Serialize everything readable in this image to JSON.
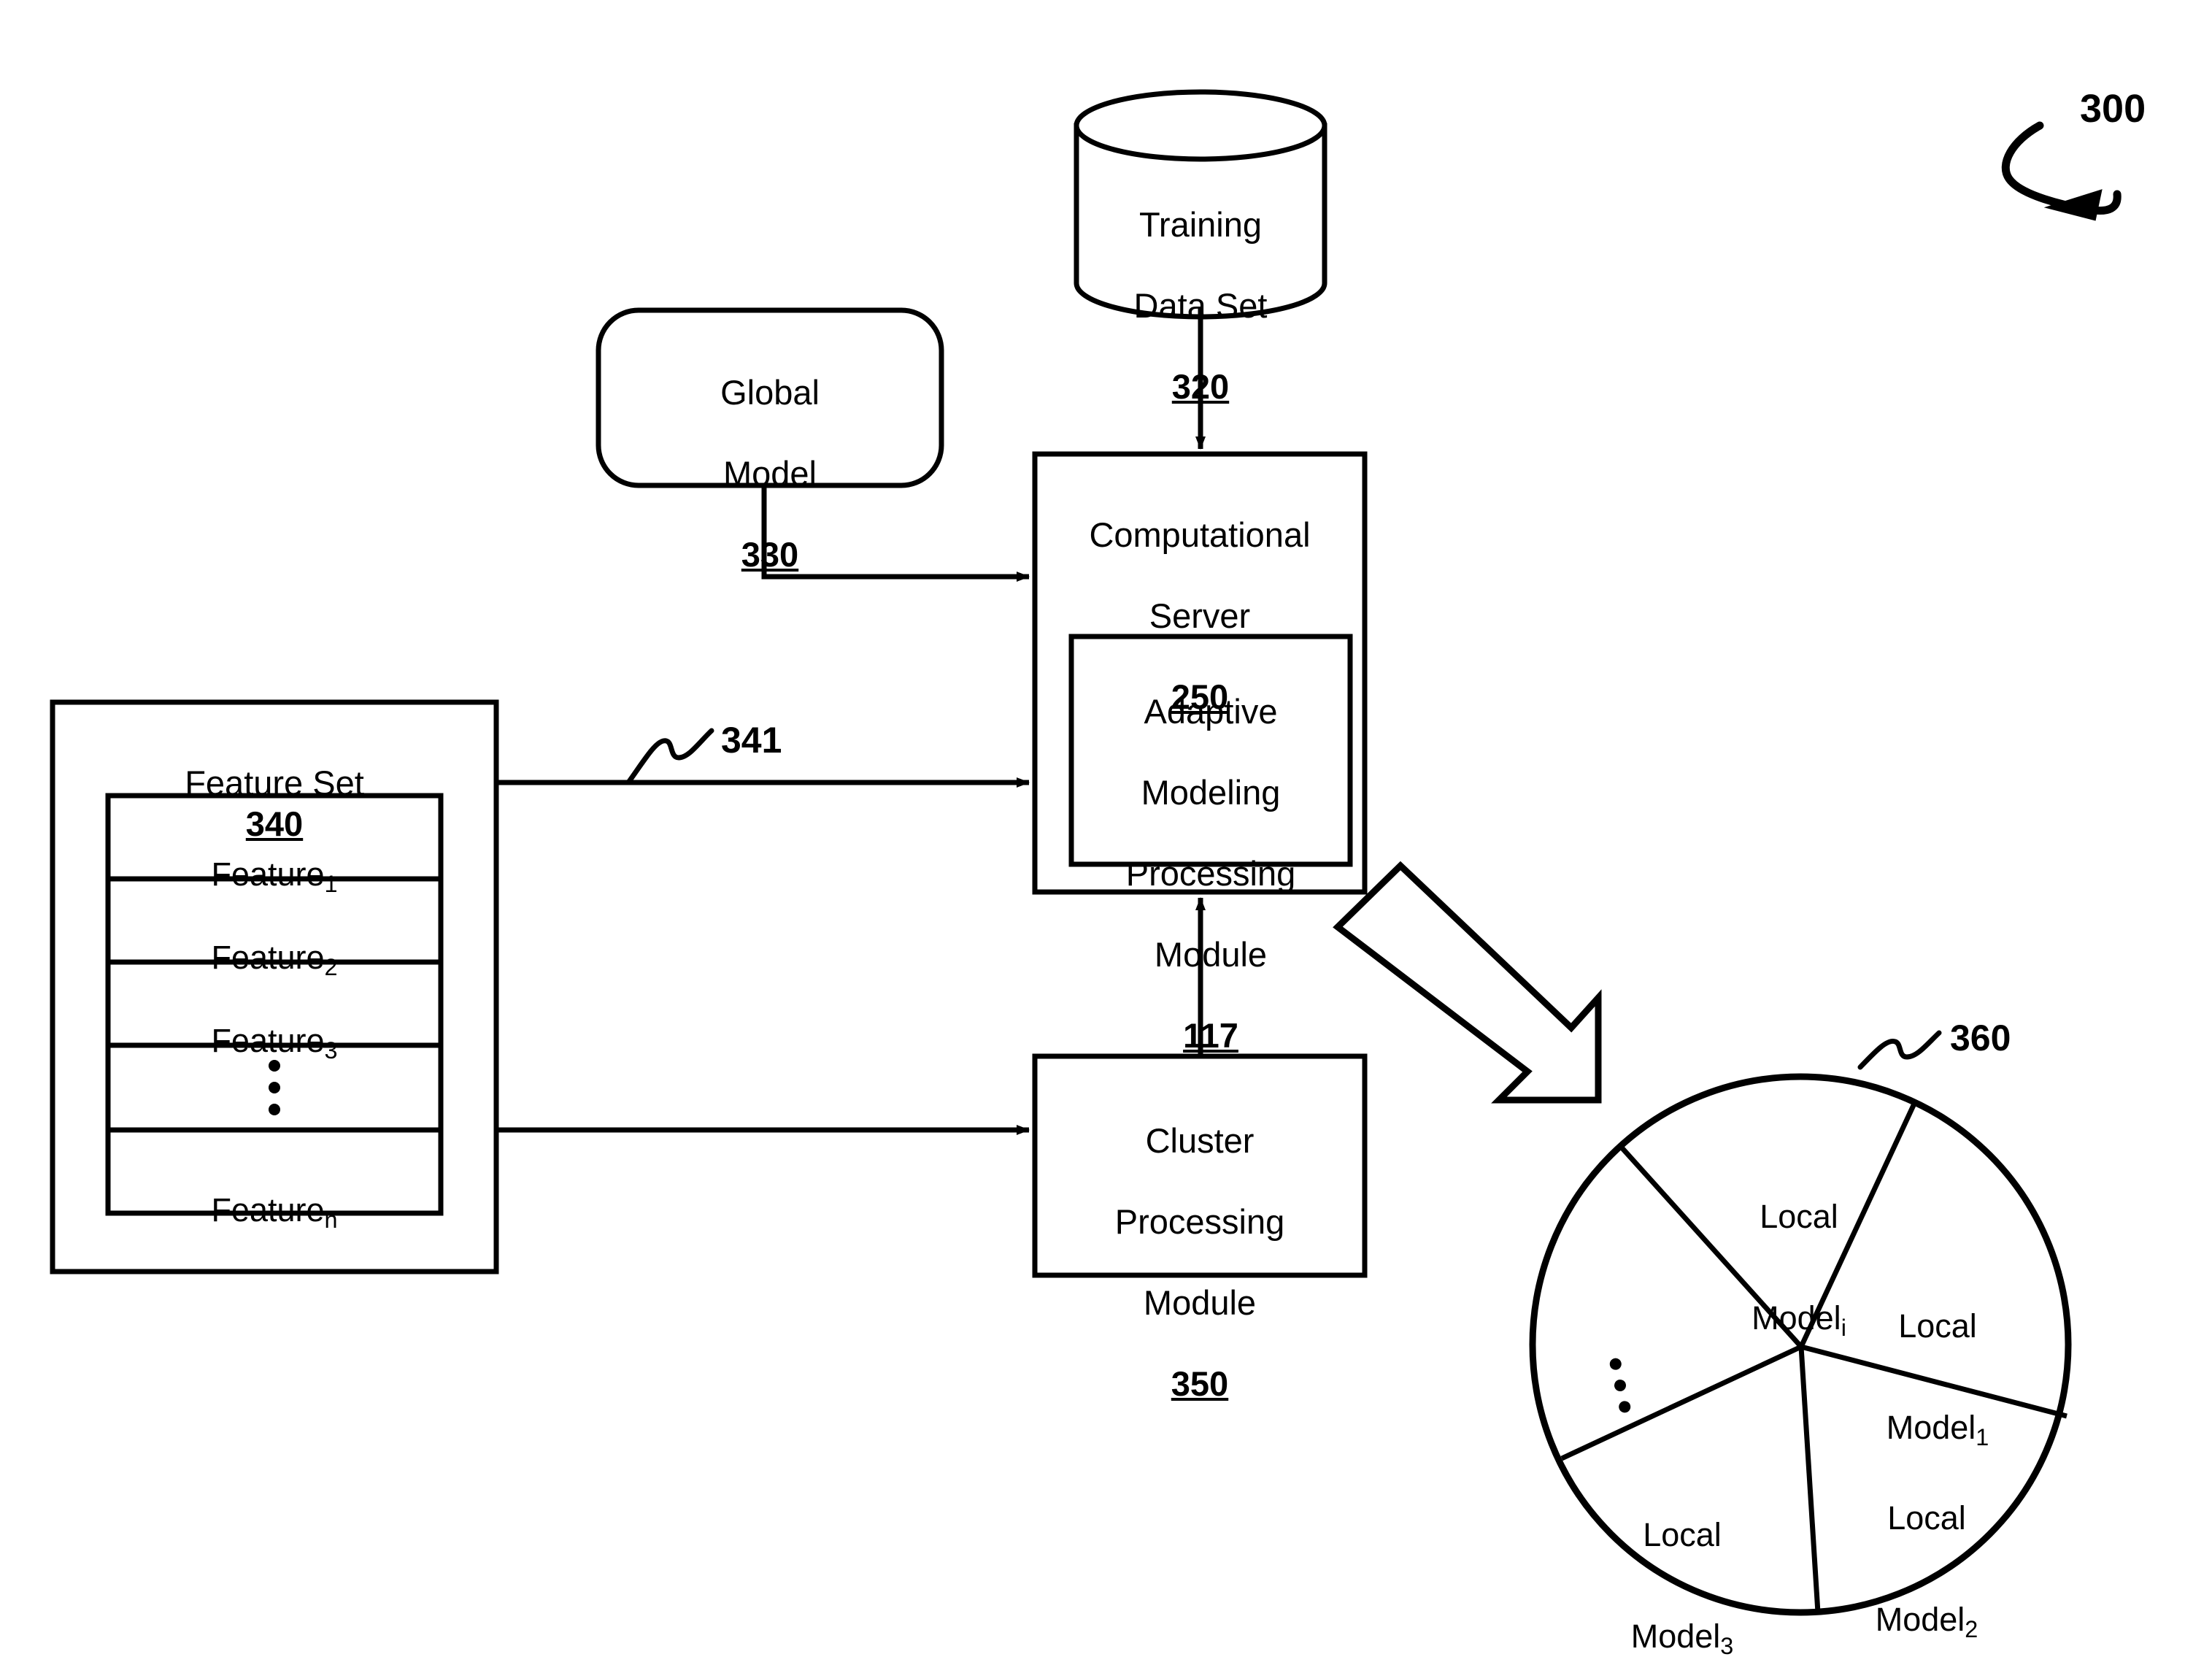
{
  "figure": {
    "number": "300",
    "type": "patent-block-diagram"
  },
  "nodes": {
    "training_data": {
      "title_line1": "Training",
      "title_line2": "Data Set",
      "ref": "320",
      "shape": "cylinder"
    },
    "global_model": {
      "title_line1": "Global",
      "title_line2": "Model",
      "ref": "330",
      "shape": "rounded-rect"
    },
    "computational_server": {
      "title_line1": "Computational",
      "title_line2": "Server",
      "ref": "250",
      "shape": "rect"
    },
    "adaptive_module": {
      "title_line1": "Adaptive",
      "title_line2": "Modeling",
      "title_line3": "Processing",
      "title_line4": "Module",
      "ref": "117",
      "shape": "rect"
    },
    "cluster_module": {
      "title_line1": "Cluster",
      "title_line2": "Processing",
      "title_line3": "Module",
      "ref": "350",
      "shape": "rect"
    },
    "feature_set": {
      "title": "Feature Set",
      "ref": "340",
      "shape": "rect",
      "rows": [
        {
          "label": "Feature",
          "sub": "1",
          "kind": "text"
        },
        {
          "label": "Feature",
          "sub": "2",
          "kind": "text"
        },
        {
          "label": "Feature",
          "sub": "3",
          "kind": "text"
        },
        {
          "label": "",
          "sub": "",
          "kind": "vertical-dots"
        },
        {
          "label": "Feature",
          "sub": "n",
          "kind": "text"
        }
      ]
    },
    "local_models_pie": {
      "ref": "360",
      "shape": "pie"
    }
  },
  "chart_data": {
    "type": "pie",
    "title": "",
    "ref": "360",
    "legend_position": "inside-slices",
    "slices": [
      {
        "label_line1": "Local",
        "label_line2": "Model",
        "sub": "i",
        "start_deg": 235,
        "end_deg": 295
      },
      {
        "label_line1": "Local",
        "label_line2": "Model",
        "sub": "1",
        "start_deg": 295,
        "end_deg": 16
      },
      {
        "label_line1": "Local",
        "label_line2": "Model",
        "sub": "2",
        "start_deg": 16,
        "end_deg": 86
      },
      {
        "label_line1": "Local",
        "label_line2": "Model",
        "sub": "3",
        "start_deg": 86,
        "end_deg": 192
      },
      {
        "label_line1": "",
        "label_line2": "",
        "sub": "",
        "start_deg": 192,
        "end_deg": 235,
        "kind": "vertical-dots"
      }
    ]
  },
  "connectors": {
    "training_to_server": {
      "ref": "",
      "style": "line-arrow",
      "from": "training_data",
      "to": "computational_server"
    },
    "global_to_server": {
      "ref": "",
      "style": "elbow-arrow",
      "from": "global_model",
      "to": "computational_server"
    },
    "featureset_to_server": {
      "ref": "341",
      "style": "line-arrow",
      "from": "feature_set",
      "to": "computational_server"
    },
    "featureset_to_cluster": {
      "ref": "",
      "style": "line-arrow",
      "from": "feature_set",
      "to": "cluster_module"
    },
    "cluster_to_server": {
      "ref": "",
      "style": "line-arrow",
      "from": "cluster_module",
      "to": "computational_server"
    },
    "server_to_pie": {
      "ref": "",
      "style": "block-arrow",
      "from": "computational_server",
      "to": "local_models_pie"
    }
  },
  "colors": {
    "stroke": "#000000",
    "background": "#ffffff",
    "fill": "#ffffff"
  }
}
